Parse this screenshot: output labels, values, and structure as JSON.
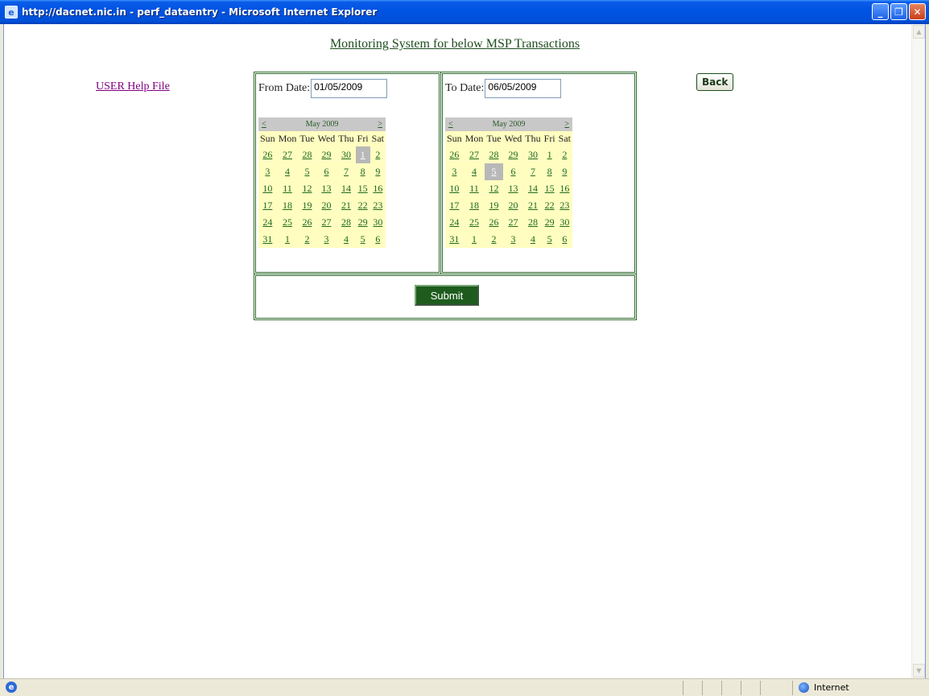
{
  "window": {
    "title": "http://dacnet.nic.in - perf_dataentry - Microsoft Internet Explorer",
    "minimize_glyph": "_",
    "restore_glyph": "❐",
    "close_glyph": "✕"
  },
  "page": {
    "title": "Monitoring System for below MSP Transactions",
    "help_link": "USER Help File",
    "back_label": "Back",
    "submit_label": "Submit"
  },
  "from": {
    "label": "From Date:",
    "value": "01/05/2009",
    "calendar": {
      "month_label": "May 2009",
      "prev": "<",
      "next": ">",
      "weekdays": [
        "Sun",
        "Mon",
        "Tue",
        "Wed",
        "Thu",
        "Fri",
        "Sat"
      ],
      "weeks": [
        [
          "26",
          "27",
          "28",
          "29",
          "30",
          "1",
          "2"
        ],
        [
          "3",
          "4",
          "5",
          "6",
          "7",
          "8",
          "9"
        ],
        [
          "10",
          "11",
          "12",
          "13",
          "14",
          "15",
          "16"
        ],
        [
          "17",
          "18",
          "19",
          "20",
          "21",
          "22",
          "23"
        ],
        [
          "24",
          "25",
          "26",
          "27",
          "28",
          "29",
          "30"
        ],
        [
          "31",
          "1",
          "2",
          "3",
          "4",
          "5",
          "6"
        ]
      ],
      "selected_day": "1"
    }
  },
  "to": {
    "label": "To Date:",
    "value": "06/05/2009",
    "calendar": {
      "month_label": "May 2009",
      "prev": "<",
      "next": ">",
      "weekdays": [
        "Sun",
        "Mon",
        "Tue",
        "Wed",
        "Thu",
        "Fri",
        "Sat"
      ],
      "weeks": [
        [
          "26",
          "27",
          "28",
          "29",
          "30",
          "1",
          "2"
        ],
        [
          "3",
          "4",
          "5",
          "6",
          "7",
          "8",
          "9"
        ],
        [
          "10",
          "11",
          "12",
          "13",
          "14",
          "15",
          "16"
        ],
        [
          "17",
          "18",
          "19",
          "20",
          "21",
          "22",
          "23"
        ],
        [
          "24",
          "25",
          "26",
          "27",
          "28",
          "29",
          "30"
        ],
        [
          "31",
          "1",
          "2",
          "3",
          "4",
          "5",
          "6"
        ]
      ],
      "selected_day": "5"
    }
  },
  "statusbar": {
    "zone": "Internet"
  },
  "colors": {
    "accent_green": "#2e6b2e",
    "calendar_bg": "#fffdc0",
    "link_purple": "#800080"
  }
}
